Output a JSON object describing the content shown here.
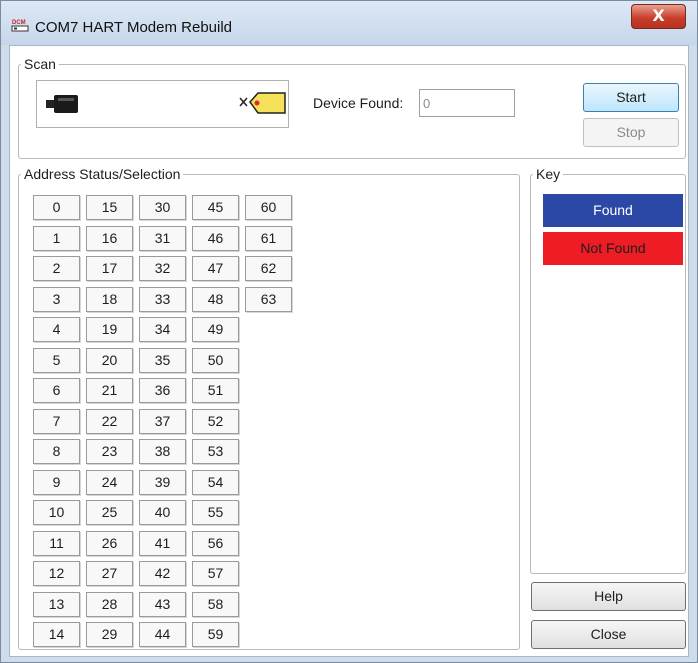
{
  "window": {
    "title": "COM7 HART Modem Rebuild",
    "app_icon": "dcm-modem-icon",
    "close_label": "X"
  },
  "scan": {
    "legend": "Scan",
    "device_found_label": "Device Found:",
    "device_found_value": "0",
    "start_label": "Start",
    "stop_label": "Stop",
    "stop_enabled": false
  },
  "address": {
    "legend": "Address Status/Selection",
    "addresses": [
      0,
      1,
      2,
      3,
      4,
      5,
      6,
      7,
      8,
      9,
      10,
      11,
      12,
      13,
      14,
      15,
      16,
      17,
      18,
      19,
      20,
      21,
      22,
      23,
      24,
      25,
      26,
      27,
      28,
      29,
      30,
      31,
      32,
      33,
      34,
      35,
      36,
      37,
      38,
      39,
      40,
      41,
      42,
      43,
      44,
      45,
      46,
      47,
      48,
      49,
      50,
      51,
      52,
      53,
      54,
      55,
      56,
      57,
      58,
      59,
      60,
      61,
      62,
      63
    ]
  },
  "key": {
    "legend": "Key",
    "found_label": "Found",
    "found_color": "#2c48a6",
    "not_found_label": "Not Found",
    "not_found_color": "#ee1c24"
  },
  "footer": {
    "help_label": "Help",
    "close_label": "Close"
  }
}
